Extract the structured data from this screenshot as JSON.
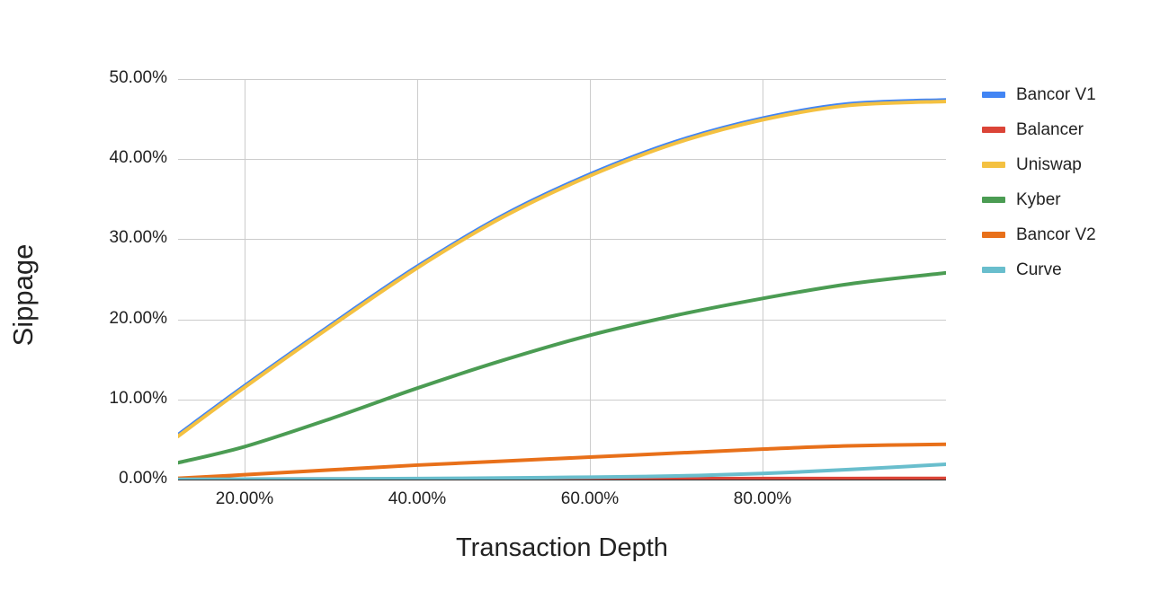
{
  "chart_data": {
    "type": "line",
    "title": "",
    "xlabel": "Transaction Depth",
    "ylabel": "Sippage",
    "xlim": [
      12.3,
      101.3
    ],
    "ylim": [
      0,
      50
    ],
    "x_tick_labels": [
      "20.00%",
      "40.00%",
      "60.00%",
      "80.00%"
    ],
    "x_ticks": [
      20,
      40,
      60,
      80
    ],
    "y_tick_labels": [
      "0.00%",
      "10.00%",
      "20.00%",
      "30.00%",
      "40.00%",
      "50.00%"
    ],
    "y_ticks": [
      0,
      10,
      20,
      30,
      40,
      50
    ],
    "grid": true,
    "legend_position": "right",
    "x": [
      12.3,
      20,
      30,
      40,
      50,
      60,
      70,
      80,
      90,
      101.3
    ],
    "series": [
      {
        "name": "Bancor V1",
        "color": "#4285f4",
        "values": [
          5.6,
          11.7,
          19.3,
          26.6,
          33.0,
          38.1,
          42.2,
          45.1,
          46.9,
          47.4
        ]
      },
      {
        "name": "Balancer",
        "color": "#db4437",
        "values": [
          0.05,
          0.06,
          0.07,
          0.08,
          0.09,
          0.1,
          0.11,
          0.12,
          0.13,
          0.14
        ]
      },
      {
        "name": "Uniswap",
        "color": "#f4c141",
        "values": [
          5.4,
          11.5,
          19.1,
          26.4,
          32.8,
          37.9,
          42.0,
          44.9,
          46.7,
          47.2
        ]
      },
      {
        "name": "Kyber",
        "color": "#4b9c53",
        "values": [
          2.1,
          4.1,
          7.6,
          11.4,
          14.9,
          18.0,
          20.5,
          22.6,
          24.4,
          25.8
        ]
      },
      {
        "name": "Bancor V2",
        "color": "#e8701a",
        "values": [
          0.15,
          0.6,
          1.2,
          1.8,
          2.3,
          2.8,
          3.3,
          3.8,
          4.2,
          4.4
        ]
      },
      {
        "name": "Curve",
        "color": "#69becd",
        "values": [
          0.03,
          0.05,
          0.08,
          0.12,
          0.2,
          0.3,
          0.45,
          0.75,
          1.25,
          1.9
        ]
      }
    ]
  },
  "legend": {
    "items": [
      {
        "label": "Bancor V1"
      },
      {
        "label": "Balancer"
      },
      {
        "label": "Uniswap"
      },
      {
        "label": "Kyber"
      },
      {
        "label": "Bancor V2"
      },
      {
        "label": "Curve"
      }
    ]
  },
  "axes": {
    "y_title": "Sippage",
    "x_title": "Transaction Depth"
  }
}
